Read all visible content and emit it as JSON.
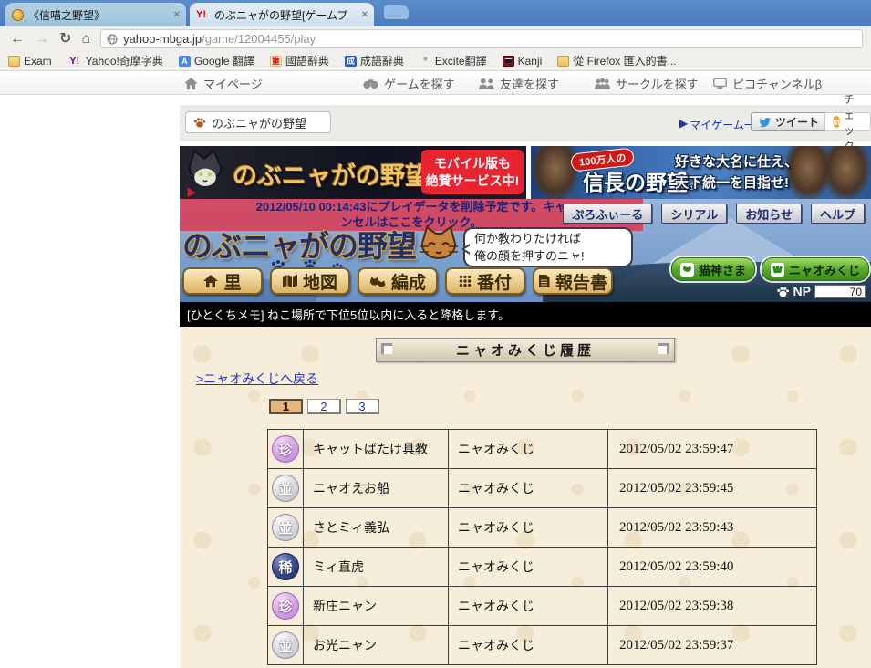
{
  "browser": {
    "tab1": {
      "title": "《信喵之野望》",
      "close": "×"
    },
    "tab2": {
      "title": "のぶニャがの野望[ゲームプ",
      "close": "×"
    },
    "back": "←",
    "forward": "→",
    "reload": "↻",
    "home": "⌂",
    "url": {
      "host": "yahoo-mbga.jp",
      "path": "/game/12004455/play"
    },
    "bookmarks": [
      {
        "label": "Exam"
      },
      {
        "label": "Yahoo!奇摩字典"
      },
      {
        "label": "Google 翻譯"
      },
      {
        "label": "國語辭典"
      },
      {
        "label": "成語辭典"
      },
      {
        "label": "Excite翻譯"
      },
      {
        "label": "Kanji"
      },
      {
        "label": "從 Firefox 匯入的書..."
      }
    ],
    "bookmark_glyphs": {
      "yahoo": "Y!",
      "gtrans": "A",
      "kokugo": "重",
      "seigo": "成",
      "excite": "*"
    }
  },
  "portal_nav": {
    "items": [
      {
        "label": "マイページ"
      },
      {
        "label": "ゲームを探す"
      },
      {
        "label": "友達を探す"
      },
      {
        "label": "サークルを探す"
      },
      {
        "label": "ピコチャンネルβ"
      }
    ]
  },
  "game_header": {
    "title": "のぶニャがの野望",
    "my_games_arrow": "▶",
    "my_games": "マイゲーム一覧",
    "tweet": "ツイート",
    "check": "チェック",
    "check_icon_letter": "m"
  },
  "banner_left": {
    "title": "のぶニャがの野望",
    "bubble_line1": "モバイル版も",
    "bubble_line2": "絶賛サービス中!"
  },
  "banner_right": {
    "badge": "100万人の",
    "title": "信長の野望",
    "reg": "®",
    "catch_line1": "好きな大名に仕え、",
    "catch_line2": "天下統一を目指せ!"
  },
  "notice": {
    "line1": "2012/05/10 00:14:43にプレイデータを削除予定です。キャ",
    "line2": "ンセルはここをクリック。"
  },
  "top_buttons": [
    {
      "label": "ぷろふぃーる"
    },
    {
      "label": "シリアル"
    },
    {
      "label": "お知らせ"
    },
    {
      "label": "ヘルプ"
    }
  ],
  "logo": {
    "title": "のぶニャがの野望",
    "speech_line1": "何か教わりたければ",
    "speech_line2": "俺の顔を押すのニャ!"
  },
  "game_nav": [
    {
      "label": "里"
    },
    {
      "label": "地図"
    },
    {
      "label": "編成"
    },
    {
      "label": "番付"
    },
    {
      "label": "報告書"
    }
  ],
  "side": {
    "nekogami": "猫神さま",
    "mikuji": "ニャオみくじ",
    "np_label": "NP",
    "np_value": "70"
  },
  "memo": {
    "text": "[ひとくちメモ] ねこ場所で下位5位以内に入ると降格します。"
  },
  "history": {
    "title": "ニャオみくじ履歴",
    "back_link": ">ニャオみくじへ戻る",
    "pages": [
      {
        "label": "1"
      },
      {
        "label": "2"
      },
      {
        "label": "3"
      }
    ],
    "rows": [
      {
        "badge": "珍",
        "name": "キャットばたけ具教",
        "type": "ニャオみくじ",
        "time": "2012/05/02 23:59:47"
      },
      {
        "badge": "並",
        "name": "ニャオえお船",
        "type": "ニャオみくじ",
        "time": "2012/05/02 23:59:45"
      },
      {
        "badge": "並",
        "name": "さとミィ義弘",
        "type": "ニャオみくじ",
        "time": "2012/05/02 23:59:43"
      },
      {
        "badge": "稀",
        "name": "ミィ直虎",
        "type": "ニャオみくじ",
        "time": "2012/05/02 23:59:40"
      },
      {
        "badge": "珍",
        "name": "新庄ニャン",
        "type": "ニャオみくじ",
        "time": "2012/05/02 23:59:38"
      },
      {
        "badge": "並",
        "name": "お光ニャン",
        "type": "ニャオみくじ",
        "time": "2012/05/02 23:59:37"
      }
    ]
  },
  "colors": {
    "tab_bar": "#4a7cbd",
    "toolbar": "#f1efec",
    "banner_red_bubble": "#e82430",
    "notice_overlay": "#d83c54",
    "sky_top": "#96b4da",
    "game_button_tan": "#eed495",
    "side_button_green": "#54a52a",
    "memo_bg": "#000000",
    "content_bg": "#f6eedb",
    "link_blue": "#2233cc",
    "badge_rare_pink": "#dfb0e8",
    "badge_common": "#c9c9cd",
    "badge_rare_blue": "#2a3a72"
  }
}
